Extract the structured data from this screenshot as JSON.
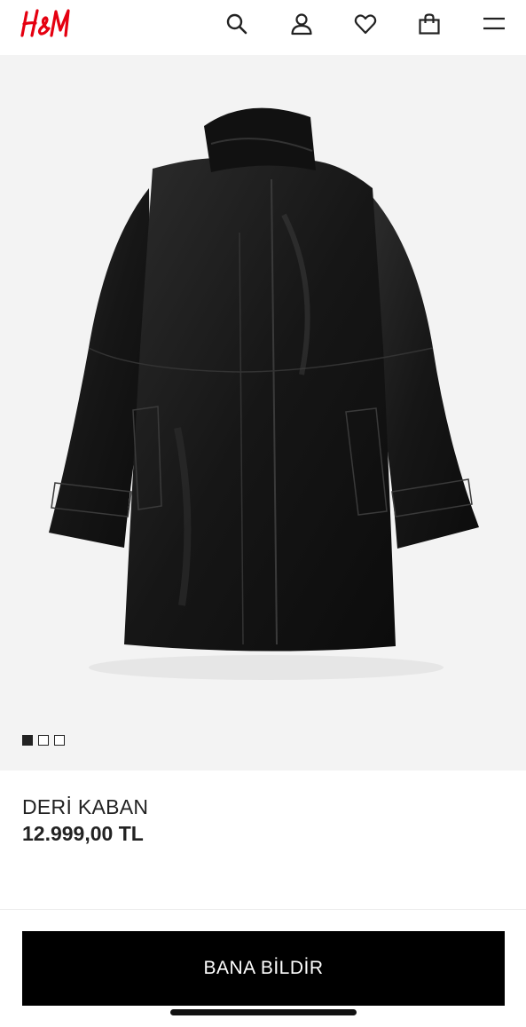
{
  "header": {
    "brand": "H&M",
    "icons": [
      "search-icon",
      "account-icon",
      "heart-icon",
      "bag-icon",
      "menu-icon"
    ],
    "brand_color": "#E50010"
  },
  "gallery": {
    "image_subject": "black leather coat",
    "image_count": 3,
    "active_index": 0,
    "background": "#f3f3f3"
  },
  "product": {
    "name": "DERİ KABAN",
    "price": "12.999,00 TL"
  },
  "actions": {
    "notify_label": "BANA BİLDİR"
  }
}
